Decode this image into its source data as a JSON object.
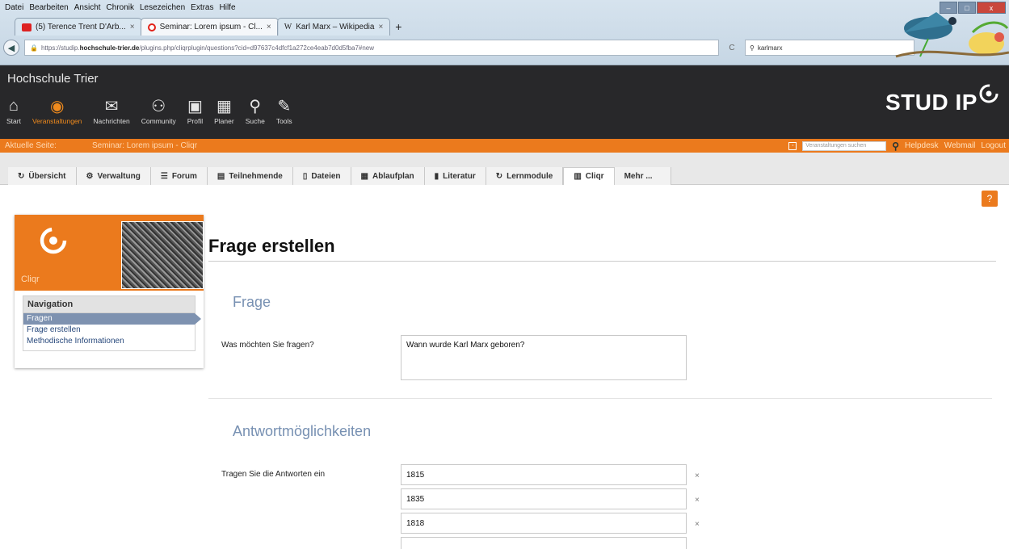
{
  "browser": {
    "menu": [
      "Datei",
      "Bearbeiten",
      "Ansicht",
      "Chronik",
      "Lesezeichen",
      "Extras",
      "Hilfe"
    ],
    "tabs": [
      {
        "title": "(5) Terence Trent D'Arb...",
        "close": "×"
      },
      {
        "title": "Seminar: Lorem ipsum - Cl...",
        "close": "×"
      },
      {
        "title": "Karl Marx – Wikipedia",
        "close": "×"
      }
    ],
    "new_tab": "+",
    "url_prefix": "https://studip.",
    "url_domain": "hochschule-trier.de",
    "url_rest": "/plugins.php/cliqrplugin/questions?cid=d97637c4dfcf1a272ce4eab7d0d5fba7#new",
    "search_value": "karlmarx"
  },
  "header": {
    "institution": "Hochschule Trier",
    "nav": [
      {
        "label": "Start",
        "icon": "home-icon",
        "glyph": "⌂"
      },
      {
        "label": "Veranstaltungen",
        "icon": "courses-icon",
        "glyph": "◉"
      },
      {
        "label": "Nachrichten",
        "icon": "mail-icon",
        "glyph": "✉"
      },
      {
        "label": "Community",
        "icon": "community-icon",
        "glyph": "👥"
      },
      {
        "label": "Profil",
        "icon": "profile-icon",
        "glyph": "▣"
      },
      {
        "label": "Planer",
        "icon": "calendar-icon",
        "glyph": "▦"
      },
      {
        "label": "Suche",
        "icon": "search-icon",
        "glyph": "⚲"
      },
      {
        "label": "Tools",
        "icon": "tools-icon",
        "glyph": "🔧"
      }
    ],
    "logo": "STUD IP"
  },
  "breadcrumb": {
    "label": "Aktuelle Seite:",
    "value": "Seminar: Lorem ipsum - Cliqr",
    "search_placeholder": "Veranstaltungen suchen",
    "links": [
      "Helpdesk",
      "Webmail",
      "Logout"
    ]
  },
  "page_tabs": [
    {
      "label": "Übersicht",
      "icon": "overview-icon",
      "glyph": "↻"
    },
    {
      "label": "Verwaltung",
      "icon": "admin-icon",
      "glyph": "⚙"
    },
    {
      "label": "Forum",
      "icon": "forum-icon",
      "glyph": "☰"
    },
    {
      "label": "Teilnehmende",
      "icon": "participants-icon",
      "glyph": "▤"
    },
    {
      "label": "Dateien",
      "icon": "files-icon",
      "glyph": "▯"
    },
    {
      "label": "Ablaufplan",
      "icon": "schedule-icon",
      "glyph": "▦"
    },
    {
      "label": "Literatur",
      "icon": "literature-icon",
      "glyph": "▮"
    },
    {
      "label": "Lernmodule",
      "icon": "modules-icon",
      "glyph": "↻"
    },
    {
      "label": "Cliqr",
      "icon": "cliqr-icon",
      "glyph": "▥"
    },
    {
      "label": "Mehr ...",
      "icon": "",
      "glyph": ""
    }
  ],
  "sidebar": {
    "title": "Cliqr",
    "nav_heading": "Navigation",
    "items": [
      "Fragen",
      "Frage erstellen",
      "Methodische Informationen"
    ]
  },
  "main": {
    "title": "Frage erstellen",
    "section1": "Frage",
    "question_label": "Was möchten Sie fragen?",
    "question_value": "Wann wurde Karl Marx geboren?",
    "section2": "Antwortmöglichkeiten",
    "answers_label": "Tragen Sie die Antworten ein",
    "answers": [
      "1815",
      "1835",
      "1818"
    ],
    "remove": "×",
    "help": "?"
  }
}
